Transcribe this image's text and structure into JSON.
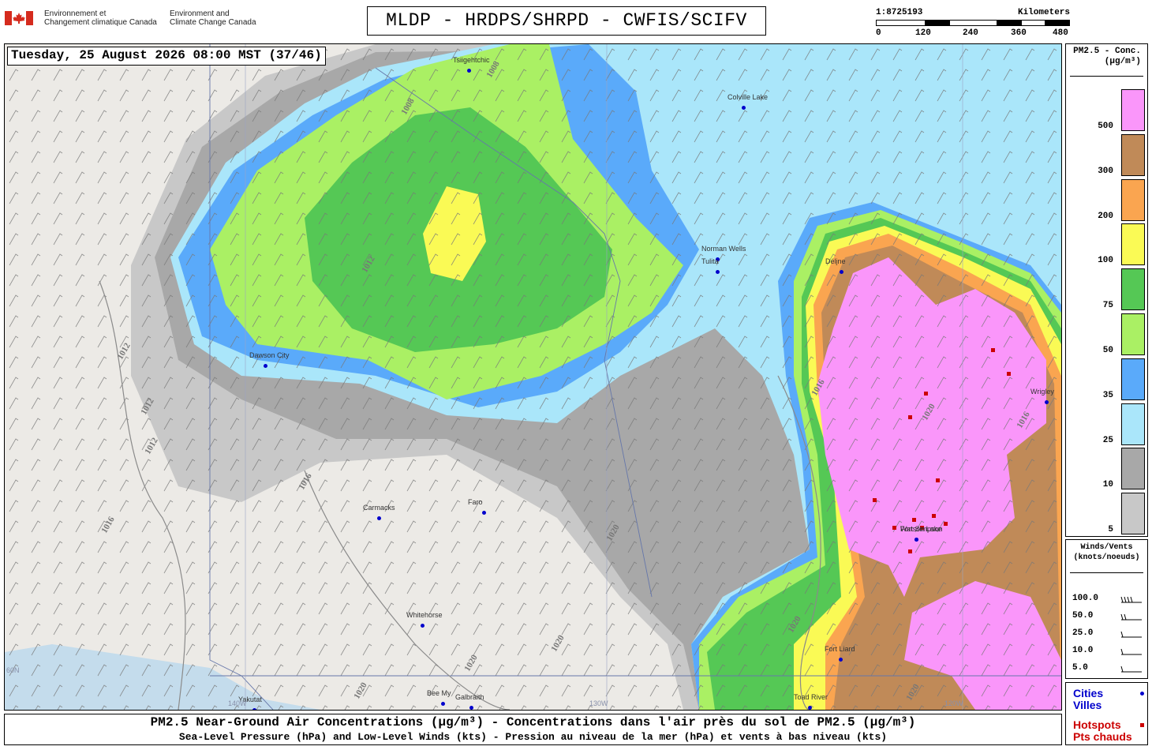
{
  "header": {
    "gov_fr": [
      "Environnement et",
      "Changement climatique Canada"
    ],
    "gov_en": [
      "Environment and",
      "Climate Change Canada"
    ],
    "title": "MLDP - HRDPS/SHRPD - CWFIS/SCIFV"
  },
  "scale": {
    "ratio": "1:8725193",
    "unit": "Kilometers",
    "ticks": [
      "0",
      "120",
      "240",
      "360",
      "480"
    ]
  },
  "map": {
    "datetime": "Tuesday, 25 August 2026 08:00 MST (37/46)",
    "cities": [
      "Tsiigehtchic",
      "Colville Lake",
      "Norman Wells",
      "Tulita",
      "Délįne",
      "Dawson City",
      "Carmacks",
      "Faro",
      "Whitehorse",
      "Watson Lake",
      "Fort Simpson",
      "Wrigley",
      "Fort Liard",
      "Yakutat",
      "Galbraith",
      "Toad River",
      "Bee My"
    ],
    "isobars": [
      "1008",
      "1008",
      "1012",
      "1012",
      "1012",
      "1012",
      "1016",
      "1016",
      "1016",
      "1016",
      "1020",
      "1020",
      "1020",
      "1020",
      "1020",
      "1020",
      "1020"
    ],
    "graticule": [
      "60N",
      "140W",
      "130W",
      "120W"
    ]
  },
  "legend": {
    "title": [
      "PM2.5 - Conc.",
      "(µg/m³)"
    ],
    "bins": [
      {
        "label": "500",
        "color": "#FA96FA"
      },
      {
        "label": "300",
        "color": "#C08A58"
      },
      {
        "label": "200",
        "color": "#FAA550"
      },
      {
        "label": "100",
        "color": "#FAFA55"
      },
      {
        "label": "75",
        "color": "#55C855"
      },
      {
        "label": "50",
        "color": "#AAF064"
      },
      {
        "label": "35",
        "color": "#5AAAFA"
      },
      {
        "label": "25",
        "color": "#AAE6FA"
      },
      {
        "label": "10",
        "color": "#A8A8A8"
      },
      {
        "label": "5",
        "color": "#C8C8C8"
      }
    ]
  },
  "winds": {
    "title": [
      "Winds/Vents",
      "(knots/noeuds)"
    ],
    "rows": [
      "100.0",
      "50.0",
      "25.0",
      "10.0",
      "5.0"
    ]
  },
  "cities_legend": {
    "cities": [
      "Cities",
      "Villes"
    ],
    "hotspots": [
      "Hotspots",
      "Pts chauds"
    ],
    "city_color": "#0000CC",
    "hotspot_color": "#CC0000"
  },
  "caption": {
    "line1": "PM2.5 Near-Ground Air Concentrations (µg/m³) - Concentrations dans l'air près du sol de PM2.5 (µg/m³)",
    "line2": "Sea-Level Pressure (hPa) and Low-Level Winds (kts) - Pression au niveau de la mer (hPa) et vents à bas niveau (kts)"
  }
}
